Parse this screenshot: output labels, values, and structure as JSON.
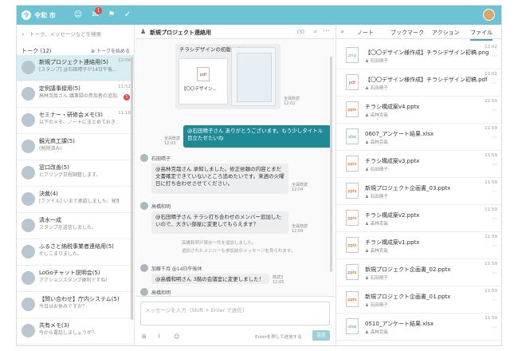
{
  "header": {
    "org": "令和 市",
    "logo": "令",
    "badge": "1"
  },
  "left": {
    "search_placeholder": "トーク、メッセージなどを検索",
    "talk_header": "トーク (12)",
    "add_talk": "トークを始める",
    "items": [
      {
        "name": "新規プロジェクト連絡用(5)",
        "preview": "[スタンプ] @石田晴子が14日午後...",
        "time": "12:06",
        "badge": ""
      },
      {
        "name": "定例議事録用(5)",
        "preview": "高林克哉さん 議事録の参加者の追加...",
        "time": "11:52",
        "badge": "1"
      },
      {
        "name": "セミナー・研修会メモ(3)",
        "preview": "以下のメモ、ノートにまとめておき...",
        "time": "11:18",
        "badge": ""
      },
      {
        "name": "観光商工課(5)",
        "preview": "(削除済み)",
        "time": "",
        "badge": ""
      },
      {
        "name": "窓口改善(5)",
        "preview": "ヒアリング日程調整します。",
        "time": "",
        "badge": ""
      },
      {
        "name": "決裁(4)",
        "preview": "[ファイル] いまで承認しました、発策...",
        "time": "",
        "badge": ""
      },
      {
        "name": "清水一成",
        "preview": "スタンプを送信しました。",
        "time": "",
        "badge": ""
      },
      {
        "name": "ふるさと納税事業者連絡用(5)",
        "preview": "かしこまりました。",
        "time": "",
        "badge": ""
      },
      {
        "name": "LoGoチャット説明会(5)",
        "preview": "アクションスタンプ便利ですね!",
        "time": "",
        "badge": ""
      },
      {
        "name": "【問い合わせ】庁内システム(5)",
        "preview": "今日はお休みですか？",
        "time": "",
        "badge": ""
      },
      {
        "name": "共有メモ(3)",
        "preview": "今から電話しましょうか？",
        "time": "",
        "badge": ""
      }
    ]
  },
  "chat": {
    "title": "新規プロジェクト連絡用",
    "count": "(5)",
    "file_msg_title": "チラシデザインの初版を共有します。",
    "file_label": "【〇〇デザイン...",
    "read1": "全員既読",
    "time1": "12:02",
    "my_msg": "@石田晴子さん ありがとうございます。もう少しタイトル目立たせたいね",
    "read2": "全員既読",
    "time2": "12:03",
    "sender1": "石田晴子",
    "msg1": "@高林克哉さん 承知しました。修正依頼の内容とまだ文書確定できていないところ追めたいです。来週の火曜日に打ち合わせさせてください。",
    "read3": "全員既読",
    "time3": "12:04",
    "sender2": "高橋和明",
    "msg2": "@石田晴子さん チラシ打ち合わせのメンバー追加したいので、大きい部屋に変更してもらえます？",
    "read4": "全員既読",
    "time4": "12:04",
    "sys1": "高橋和明が清水一共を追加しました。",
    "sys2": "追加されたメンバーも参加前のメッセージを見られます。",
    "sender3": "加藤千月 @14日午後休",
    "msg3": "@高橋和明さん 3階の会議室に変更しました！",
    "read5": "既読3",
    "time5": "12:05",
    "sender4": "高橋和明",
    "input_placeholder": "メッセージを入力（Shift + Enter で送信）",
    "enter_label": "Enterを押して送信する",
    "send_label": "送信"
  },
  "right": {
    "tabs": [
      "ノート",
      "ブックマーク",
      "アクション",
      "ファイル"
    ],
    "files": [
      {
        "name": "【〇〇デザイン様作成】チラシデザイン初稿.png",
        "user": "石田晴子",
        "time": "12:02",
        "type": "png",
        "color": "#6aa6d6"
      },
      {
        "name": "【〇〇デザイン様作成】チラシデザイン初稿.pdf",
        "user": "石田晴子",
        "time": "12:01",
        "type": "pdf",
        "color": "#c0392b"
      },
      {
        "name": "チラシ構成案v4.pptx",
        "user": "高林克哉",
        "time": "11:59",
        "type": "pptx",
        "color": "#d35400"
      },
      {
        "name": "0607_アンケート結果.xlsx",
        "user": "高林克哉",
        "time": "11:59",
        "type": "xlsx",
        "color": "#27ae60"
      },
      {
        "name": "チラシ構成案v3.pptx",
        "user": "石田晴子",
        "time": "11:59",
        "type": "pptx",
        "color": "#d35400"
      },
      {
        "name": "新規プロジェクト企画書_03.pptx",
        "user": "石田晴子",
        "time": "11:59",
        "type": "pptx",
        "color": "#d35400"
      },
      {
        "name": "チラシ構成案v2.pptx",
        "user": "高林克哉",
        "time": "11:59",
        "type": "pptx",
        "color": "#d35400"
      },
      {
        "name": "チラシ構成案v1.pptx",
        "user": "高林克哉",
        "time": "11:59",
        "type": "pptx",
        "color": "#d35400"
      },
      {
        "name": "新規プロジェクト企画書_02.pptx",
        "user": "石田晴子",
        "time": "11:59",
        "type": "pptx",
        "color": "#d35400"
      },
      {
        "name": "新規プロジェクト企画書_01.pptx",
        "user": "石田晴子",
        "time": "11:59",
        "type": "pptx",
        "color": "#d35400"
      },
      {
        "name": "0510_アンケート結果.xlsx",
        "user": "高林克哉",
        "time": "11:59",
        "type": "xlsx",
        "color": "#27ae60"
      }
    ]
  }
}
